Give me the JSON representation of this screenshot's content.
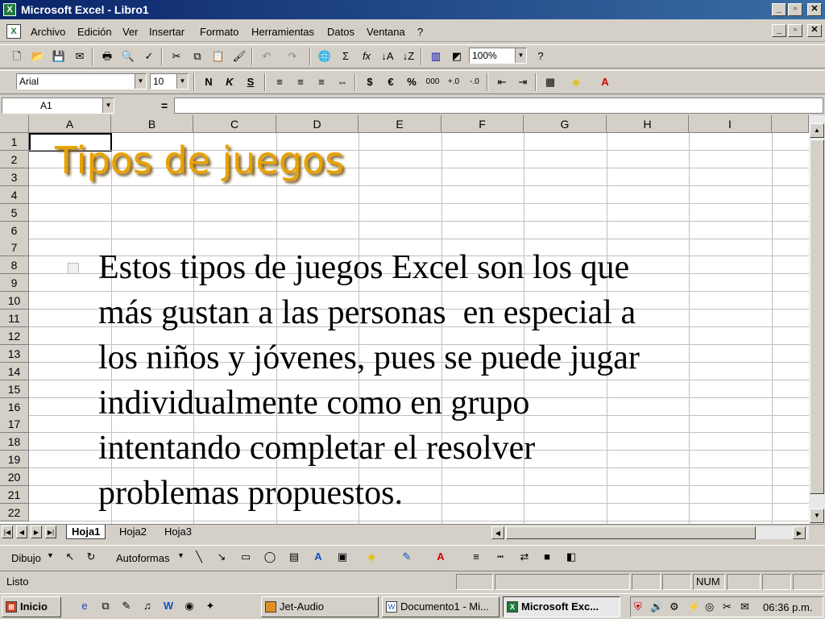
{
  "window": {
    "title": "Microsoft Excel - Libro1"
  },
  "menu": {
    "items": [
      "Archivo",
      "Edición",
      "Ver",
      "Insertar",
      "Formato",
      "Herramientas",
      "Datos",
      "Ventana",
      "?"
    ]
  },
  "toolbar_standard": {
    "zoom": "100%"
  },
  "toolbar_format": {
    "font": "Arial",
    "size": "10",
    "bold": "N",
    "italic": "K",
    "underline": "S",
    "currency": "$",
    "euro": "€",
    "percent": "%",
    "thousands": "000"
  },
  "formula_bar": {
    "name_box": "A1",
    "equals": "="
  },
  "grid": {
    "columns": [
      "A",
      "B",
      "C",
      "D",
      "E",
      "F",
      "G",
      "H",
      "I"
    ],
    "rows": [
      "1",
      "2",
      "3",
      "4",
      "5",
      "6",
      "7",
      "8",
      "9",
      "10",
      "11",
      "12",
      "13",
      "14",
      "15",
      "16",
      "17",
      "18",
      "19",
      "20",
      "21",
      "22"
    ]
  },
  "slide": {
    "title": "Tipos de juegos",
    "lines": [
      "Estos tipos de juegos Excel son los que",
      "más gustan a las personas  en especial a",
      "los niños y jóvenes, pues se puede jugar",
      "individualmente como en grupo",
      "intentando completar el resolver",
      "problemas propuestos."
    ]
  },
  "sheets": [
    "Hoja1",
    "Hoja2",
    "Hoja3"
  ],
  "drawing": {
    "dibujo": "Dibujo",
    "autoformas": "Autoformas"
  },
  "status": {
    "text": "Listo",
    "num": "NUM"
  },
  "taskbar": {
    "start": "Inicio",
    "tasks": [
      "Jet-Audio",
      "Documento1 - Mi...",
      "Microsoft Exc..."
    ],
    "clock": "06:36 p.m."
  }
}
